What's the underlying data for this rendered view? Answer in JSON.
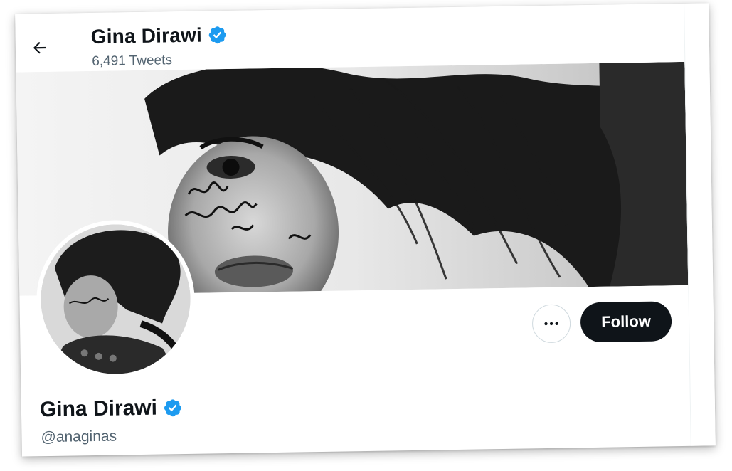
{
  "header": {
    "name": "Gina Dirawi",
    "tweet_count": "6,491 Tweets",
    "back_icon": "arrow-left-icon"
  },
  "profile": {
    "display_name": "Gina Dirawi",
    "handle": "@anaginas",
    "verified_icon": "verified-badge-icon",
    "verified_color": "#1d9bf0"
  },
  "actions": {
    "more_icon": "ellipsis-icon",
    "follow_label": "Follow"
  },
  "colors": {
    "primary_text": "#0f1419",
    "secondary_text": "#536471",
    "follow_bg": "#0f1419",
    "follow_text": "#ffffff"
  }
}
